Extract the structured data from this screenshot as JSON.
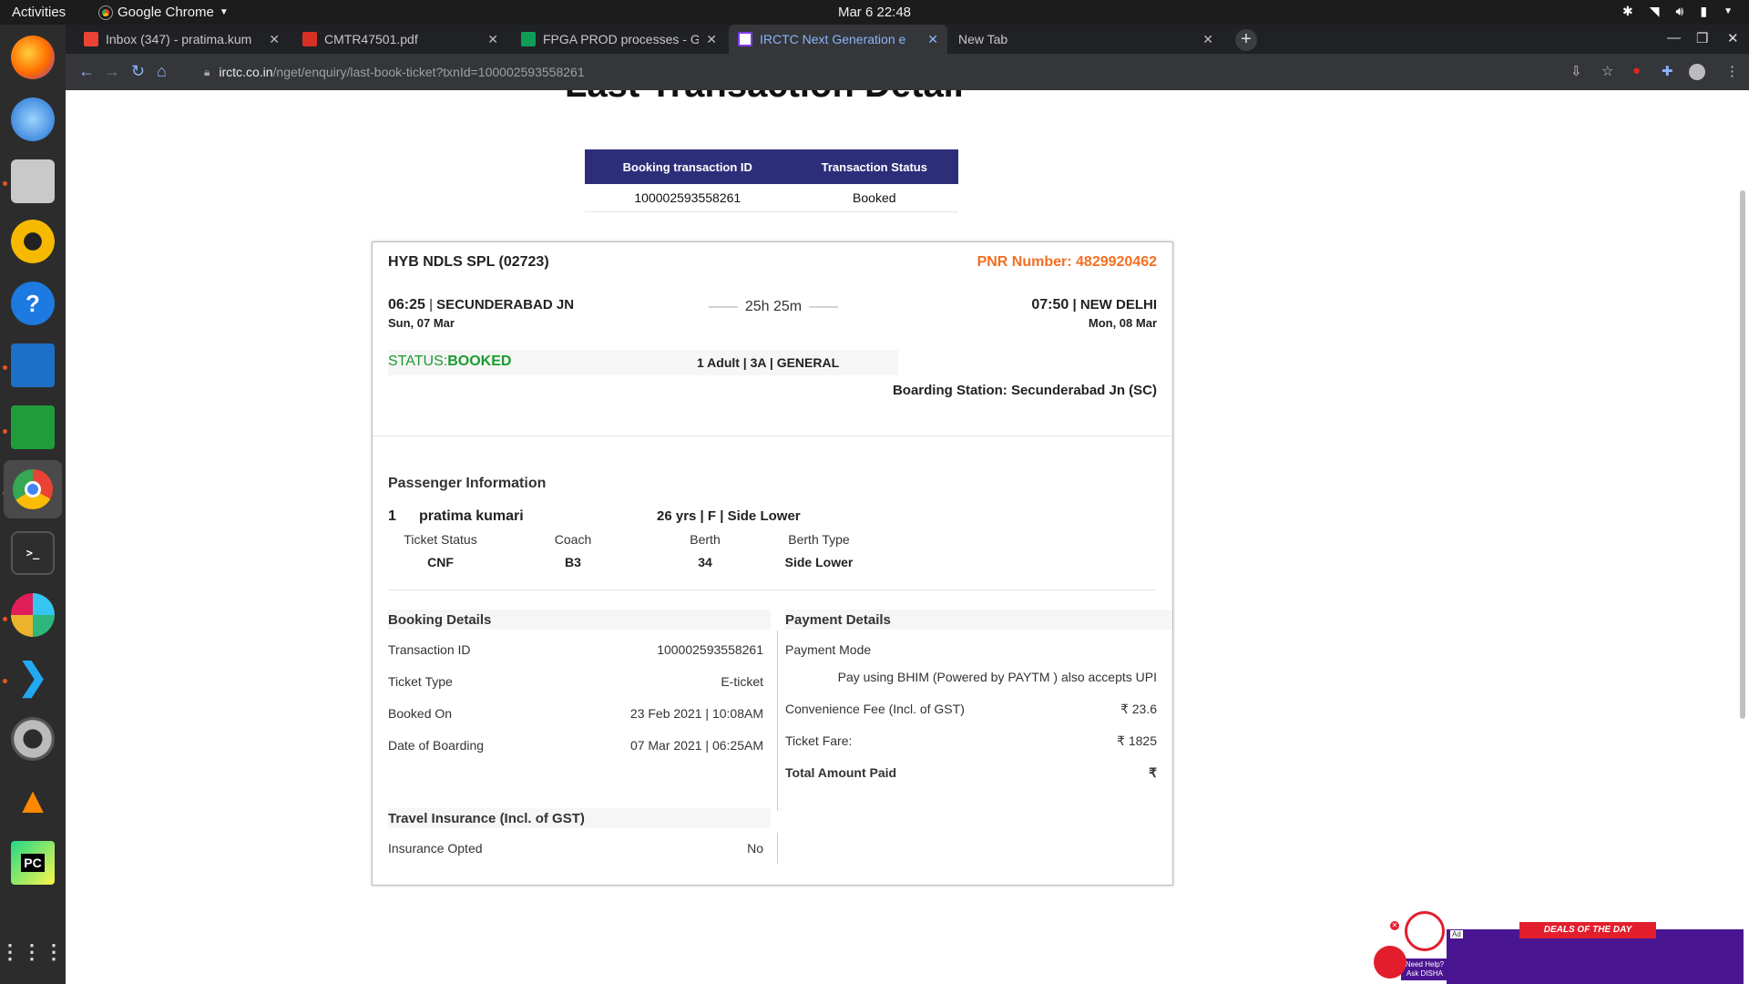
{
  "system": {
    "activities": "Activities",
    "app_menu": "Google Chrome",
    "clock": "Mar 6  22:48"
  },
  "tabs": [
    {
      "label": "Inbox (347) - pratima.kum",
      "color": "#ea4335"
    },
    {
      "label": "CMTR47501.pdf",
      "color": "#d93025"
    },
    {
      "label": "FPGA PROD processes - G",
      "color": "#0f9d58"
    },
    {
      "label": "IRCTC Next Generation e",
      "color": "#7c3aed"
    },
    {
      "label": "New Tab",
      "color": ""
    }
  ],
  "address_bar": {
    "host": "irctc.co.in",
    "path": "/nget/enquiry/last-book-ticket?txnId=100002593558261"
  },
  "page": {
    "title": "Last Transaction Detail",
    "tx_table": {
      "headers": [
        "Booking transaction ID",
        "Transaction Status"
      ],
      "row": [
        "100002593558261",
        "Booked"
      ]
    },
    "ticket": {
      "train": "HYB NDLS SPL (02723)",
      "pnr": "PNR Number: 4829920462",
      "dep_time": "06:25",
      "dep_station": "SECUNDERABAD JN",
      "dep_date": "Sun, 07 Mar",
      "duration": "25h 25m",
      "arr_time": "07:50",
      "arr_station": "NEW DELHI",
      "arr_date": "Mon, 08 Mar",
      "status_label": "STATUS:",
      "status_value": "BOOKED",
      "class_info": "1 Adult | 3A | GENERAL",
      "boarding": "Boarding Station: Secunderabad Jn (SC)"
    },
    "passenger_section": {
      "title": "Passenger Information",
      "passenger": {
        "index": "1",
        "name": "pratima kumari",
        "details": "26 yrs | F | Side Lower",
        "headers": [
          "Ticket Status",
          "Coach",
          "Berth",
          "Berth Type"
        ],
        "values": [
          "CNF",
          "B3",
          "34",
          "Side Lower"
        ]
      }
    },
    "booking_details": {
      "title": "Booking Details",
      "rows": [
        {
          "label": "Transaction ID",
          "value": "100002593558261"
        },
        {
          "label": "Ticket Type",
          "value": "E-ticket"
        },
        {
          "label": "Booked On",
          "value": "23 Feb 2021 | 10:08AM"
        },
        {
          "label": "Date of Boarding",
          "value": "07 Mar 2021 | 06:25AM"
        }
      ]
    },
    "payment_details": {
      "title": "Payment Details",
      "mode_label": "Payment Mode",
      "mode_value": "Pay using BHIM (Powered by PAYTM ) also accepts UPI",
      "rows": [
        {
          "label": "Convenience Fee (Incl. of GST)",
          "value": "₹ 23.6"
        },
        {
          "label": "Ticket Fare:",
          "value": "₹ 1825"
        },
        {
          "label": "Total Amount Paid",
          "value": "₹"
        }
      ]
    },
    "insurance": {
      "title": "Travel Insurance (Incl. of GST)",
      "label": "Insurance Opted",
      "value": "No"
    }
  },
  "ad": {
    "ribbon": "DEALS OF THE DAY",
    "help_line1": "Need Help?",
    "help_line2": "Ask DISHA",
    "tag": "Ad"
  },
  "colors": {
    "accent_orange": "#f36f21",
    "status_green": "#1a9b2f",
    "header_navy": "#2c2e7a"
  }
}
